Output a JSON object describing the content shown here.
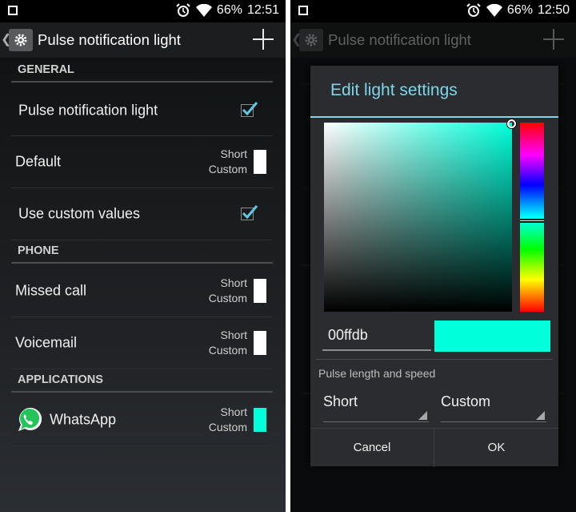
{
  "left": {
    "status": {
      "battery": "66%",
      "time": "12:51"
    },
    "action_bar": {
      "title": "Pulse notification light"
    },
    "sections": {
      "general": "GENERAL",
      "phone": "PHONE",
      "applications": "APPLICATIONS"
    },
    "rows": {
      "pulse": {
        "label": "Pulse notification light",
        "checked": true
      },
      "default": {
        "label": "Default",
        "length": "Short",
        "speed": "Custom",
        "color": "#ffffff"
      },
      "custom_values": {
        "label": "Use custom values",
        "checked": true
      },
      "missed_call": {
        "label": "Missed call",
        "length": "Short",
        "speed": "Custom",
        "color": "#ffffff"
      },
      "voicemail": {
        "label": "Voicemail",
        "length": "Short",
        "speed": "Custom",
        "color": "#ffffff"
      },
      "whatsapp": {
        "label": "WhatsApp",
        "length": "Short",
        "speed": "Custom",
        "color": "#00ffdb"
      }
    }
  },
  "right": {
    "status": {
      "battery": "66%",
      "time": "12:50"
    },
    "action_bar": {
      "title": "Pulse notification light"
    },
    "dialog": {
      "title": "Edit light settings",
      "hex_value": "00ffdb",
      "selected_color": "#00ffdb",
      "pulse_label": "Pulse length and speed",
      "length_value": "Short",
      "speed_value": "Custom",
      "cancel_label": "Cancel",
      "ok_label": "OK"
    }
  },
  "colors": {
    "accent": "#7fd6e8",
    "check": "#5fc8e6"
  },
  "icons": [
    "alarm-clock-icon",
    "wifi-icon",
    "battery-icon",
    "gear-icon",
    "add-icon",
    "checkbox-checked-icon",
    "whatsapp-icon",
    "spinner-triangle-icon"
  ]
}
